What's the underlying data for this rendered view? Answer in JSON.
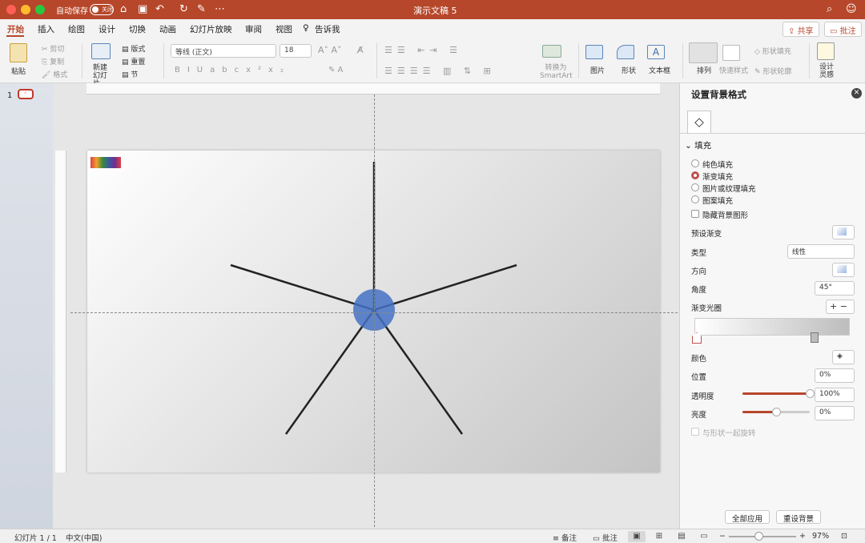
{
  "window": {
    "title": "演示文稿 5",
    "autosave_label": "自动保存",
    "autosave_state": "关闭"
  },
  "tabs": [
    "开始",
    "插入",
    "绘图",
    "设计",
    "切换",
    "动画",
    "幻灯片放映",
    "审阅",
    "视图"
  ],
  "tell_me": "告诉我",
  "share_label": "共享",
  "comment_label": "批注",
  "ribbon": {
    "paste": "粘贴",
    "cut": "剪切",
    "copy": "复制",
    "format": "格式",
    "new_slide": "新建幻灯片",
    "layout": "版式",
    "reset": "重置",
    "section": "节",
    "font_name": "等线 (正文)",
    "font_size": "18",
    "convert_smartart": "转换为SmartArt",
    "picture": "图片",
    "shape": "形状",
    "textbox": "文本框",
    "arrange": "排列",
    "quick_styles": "快速样式",
    "shape_fill": "形状填充",
    "shape_outline": "形状轮廓",
    "design_ideas": "设计灵感"
  },
  "thumbnails": {
    "slide_number": "1"
  },
  "panel": {
    "title": "设置背景格式",
    "section": "填充",
    "fill_options": [
      {
        "label": "纯色填充",
        "selected": false
      },
      {
        "label": "渐变填充",
        "selected": true
      },
      {
        "label": "图片或纹理填充",
        "selected": false
      },
      {
        "label": "图案填充",
        "selected": false
      }
    ],
    "hide_bg": "隐藏背景图形",
    "preset_gradient": "预设渐变",
    "type_label": "类型",
    "type_value": "线性",
    "direction_label": "方向",
    "angle_label": "角度",
    "angle_value": "45°",
    "stops_label": "渐变光圈",
    "color_label": "颜色",
    "position_label": "位置",
    "position_value": "0%",
    "transparency_label": "透明度",
    "transparency_value": "100%",
    "brightness_label": "亮度",
    "brightness_value": "0%",
    "rotate_with_shape": "与形状一起旋转",
    "apply_all": "全部应用",
    "reset_bg": "重设背景",
    "transparency_level": 1.0,
    "brightness_level": 0.5
  },
  "status": {
    "slide_count": "幻灯片 1 / 1",
    "language": "中文(中国)",
    "notes": "备注",
    "comments": "批注",
    "zoom": "97%"
  },
  "colors": {
    "accent": "#b7472a",
    "circle": "#4472c4"
  }
}
